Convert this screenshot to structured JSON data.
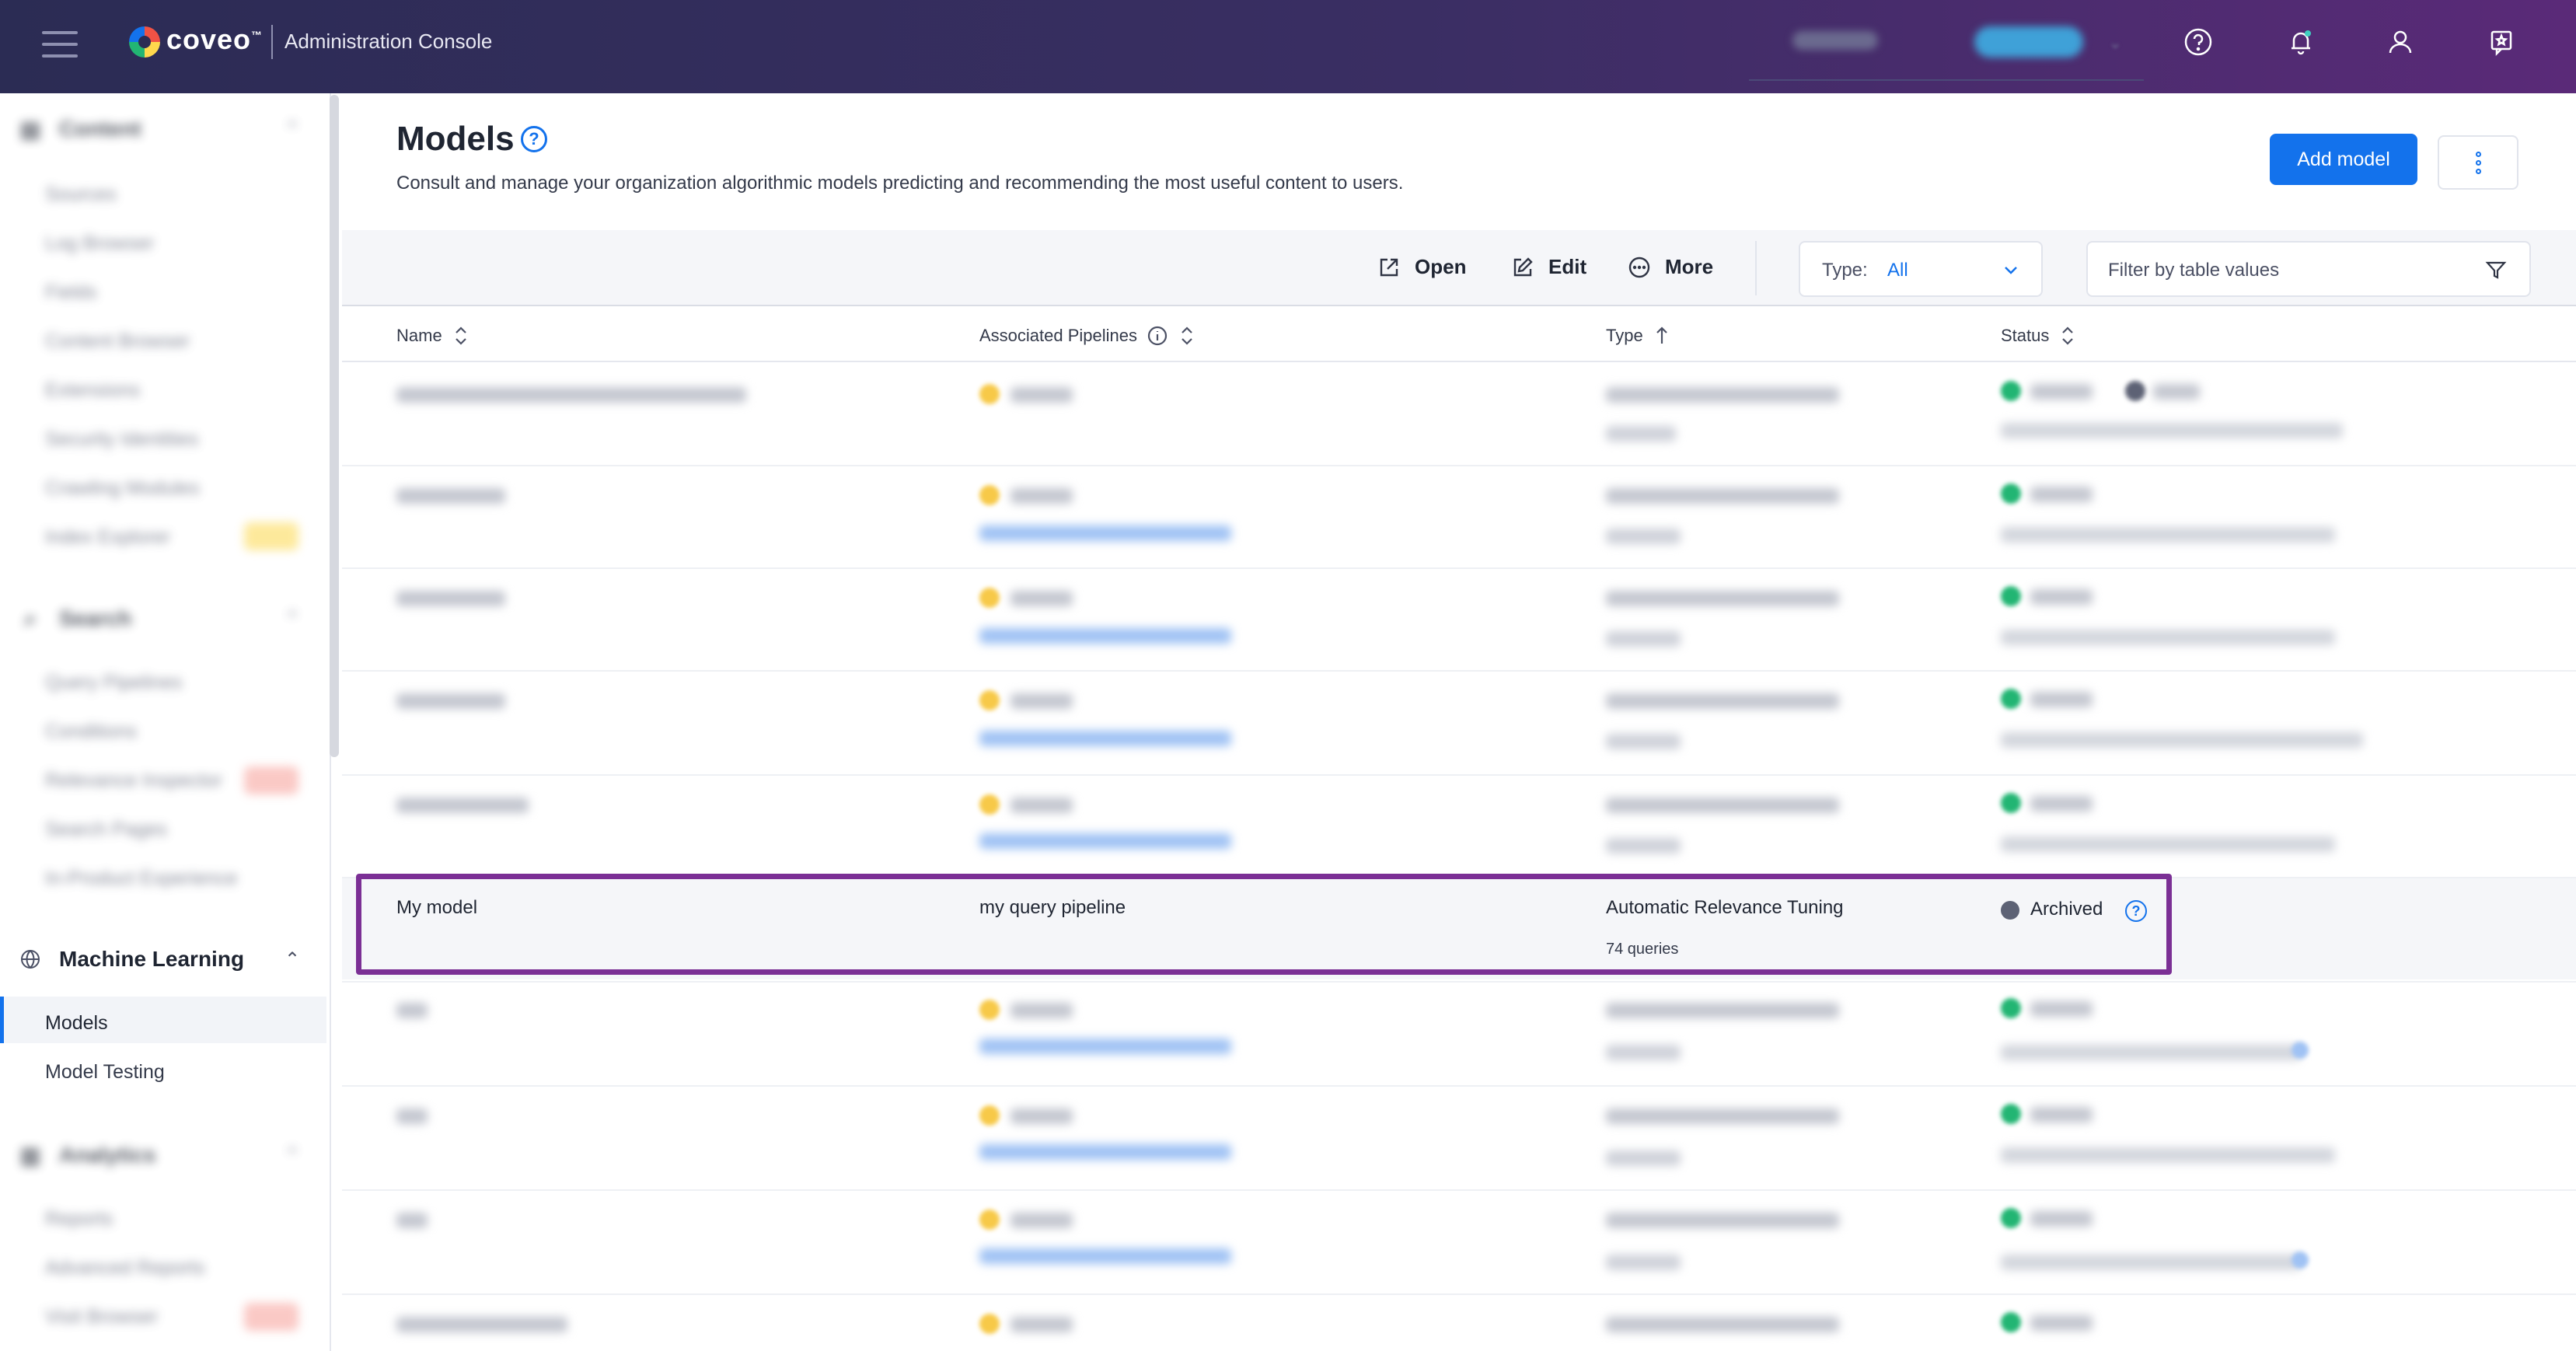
{
  "header": {
    "brand": "coveo",
    "brand_tm": "™",
    "console_title": "Administration Console"
  },
  "sidebar": {
    "sections": [
      {
        "label": "Content",
        "items": [
          "Sources",
          "Log Browser",
          "Fields",
          "Content Browser",
          "Extensions",
          "Security Identities",
          "Crawling Modules",
          "Index Explorer"
        ]
      },
      {
        "label": "Search",
        "items": [
          "Query Pipelines",
          "Conditions",
          "Relevance Inspector",
          "Search Pages",
          "In-Product Experience"
        ]
      },
      {
        "label": "Machine Learning",
        "items": [
          "Models",
          "Model Testing"
        ],
        "active": "Models"
      },
      {
        "label": "Analytics",
        "items": [
          "Reports",
          "Advanced Reports",
          "Visit Browser"
        ]
      }
    ]
  },
  "page": {
    "title": "Models",
    "help": "?",
    "description": "Consult and manage your organization algorithmic models predicting and recommending the most useful content to users.",
    "add_button": "Add model"
  },
  "toolbar": {
    "open": "Open",
    "edit": "Edit",
    "more": "More",
    "type_label": "Type:",
    "type_value": "All",
    "filter_placeholder": "Filter by table values"
  },
  "table": {
    "columns": [
      "Name",
      "Associated Pipelines",
      "Type",
      "Status"
    ],
    "highlighted_row": {
      "name": "My model",
      "pipeline": "my query pipeline",
      "type": "Automatic Relevance Tuning",
      "queries": "74 queries",
      "status": "Archived"
    }
  },
  "colors": {
    "header_start": "#2b2c54",
    "header_end": "#5a2a78",
    "accent": "#1372ec",
    "highlight_border": "#7b2f95",
    "active_green": "#22b573",
    "archived_gray": "#5d6275"
  }
}
